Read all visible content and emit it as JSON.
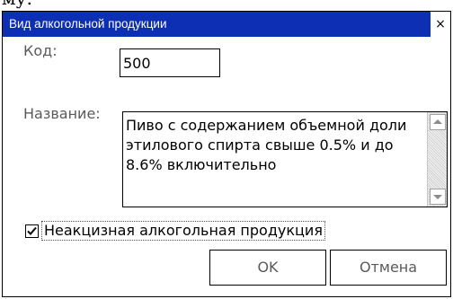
{
  "dialog": {
    "title": "Вид алкогольной продукции",
    "close_label": "×"
  },
  "form": {
    "code_label": "Код:",
    "code_value": "500",
    "name_label": "Название:",
    "name_value": "Пиво с содержанием объемной доли\nэтилового спирта свыше 0.5% и до\n8.6% включительно",
    "non_excise_label": "Неакцизная алкогольная продукция",
    "non_excise_checked": true
  },
  "buttons": {
    "ok_label": "OK",
    "cancel_label": "Отмена"
  },
  "colors": {
    "titlebar": "#0d2fb4",
    "label_gray": "#5a5a5a"
  },
  "icons": {
    "close": "close-icon",
    "scroll_up": "arrow-up-icon",
    "scroll_down": "arrow-down-icon",
    "check": "checkmark-icon"
  }
}
